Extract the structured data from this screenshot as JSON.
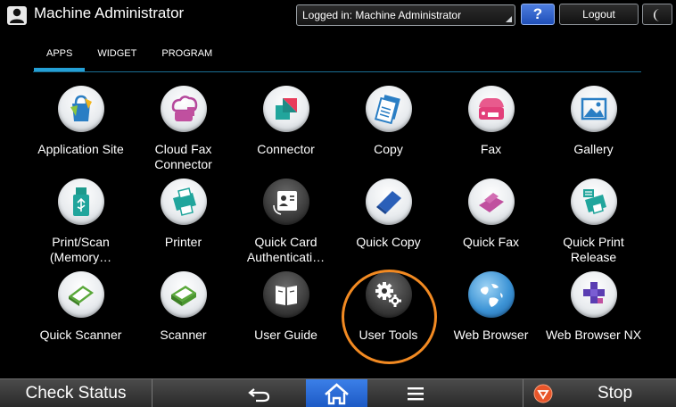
{
  "header": {
    "title": "Machine Administrator",
    "login_status": "Logged in: Machine Administrator",
    "help_label": "?",
    "logout_label": "Logout"
  },
  "tabs": [
    {
      "label": "APPS",
      "active": true
    },
    {
      "label": "WIDGET",
      "active": false
    },
    {
      "label": "PROGRAM",
      "active": false
    }
  ],
  "apps": [
    {
      "label": "Application Site",
      "icon": "shopping-bag-icon"
    },
    {
      "label": "Cloud Fax Connector",
      "icon": "cloud-fax-icon"
    },
    {
      "label": "Connector",
      "icon": "connector-icon"
    },
    {
      "label": "Copy",
      "icon": "copy-icon"
    },
    {
      "label": "Fax",
      "icon": "fax-icon"
    },
    {
      "label": "Gallery",
      "icon": "gallery-icon"
    },
    {
      "label": "Print/Scan (Memory…",
      "icon": "usb-memory-icon"
    },
    {
      "label": "Printer",
      "icon": "printer-icon"
    },
    {
      "label": "Quick Card Authenticati…",
      "icon": "id-card-icon"
    },
    {
      "label": "Quick Copy",
      "icon": "quick-copy-icon"
    },
    {
      "label": "Quick Fax",
      "icon": "quick-fax-icon"
    },
    {
      "label": "Quick Print Release",
      "icon": "print-release-icon"
    },
    {
      "label": "Quick Scanner",
      "icon": "quick-scanner-icon"
    },
    {
      "label": "Scanner",
      "icon": "scanner-icon"
    },
    {
      "label": "User Guide",
      "icon": "book-icon"
    },
    {
      "label": "User Tools",
      "icon": "gear-icon"
    },
    {
      "label": "Web Browser",
      "icon": "globe-icon"
    },
    {
      "label": "Web Browser NX",
      "icon": "puzzle-icon"
    }
  ],
  "bottombar": {
    "check_status_label": "Check Status",
    "stop_label": "Stop"
  },
  "colors": {
    "tab_underline": "#24a0d6",
    "home_button": "#2a6fdc",
    "annotation_ring": "#f28a22"
  }
}
